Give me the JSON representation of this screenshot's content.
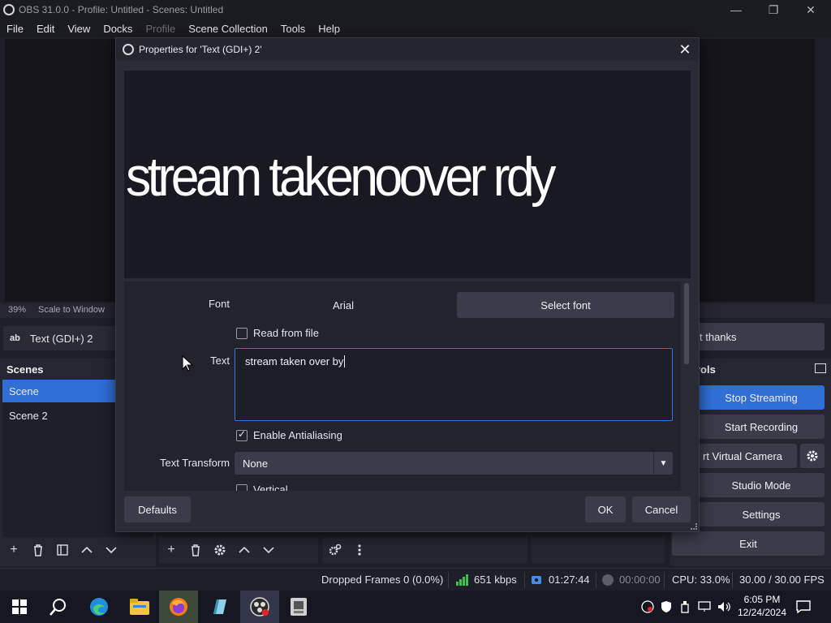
{
  "window": {
    "title": "OBS 31.0.0 - Profile: Untitled - Scenes: Untitled"
  },
  "menu": {
    "items": [
      "File",
      "Edit",
      "View",
      "Docks",
      "Profile",
      "Scene Collection",
      "Tools",
      "Help"
    ]
  },
  "preview": {
    "zoom": "39%",
    "scale_label": "Scale to Window"
  },
  "sources": {
    "icon_text": "ab",
    "selected": "Text (GDI+) 2",
    "other": "t thanks"
  },
  "scenes": {
    "title": "Scenes",
    "items": [
      "Scene",
      "Scene 2"
    ],
    "active_index": 0
  },
  "controls": {
    "title": "rols",
    "stop_streaming": "Stop Streaming",
    "start_recording": "Start Recording",
    "virtual_camera": "rt Virtual Camera",
    "studio_mode": "Studio Mode",
    "settings": "Settings",
    "exit": "Exit"
  },
  "status": {
    "dropped": "Dropped Frames 0 (0.0%)",
    "bitrate": "651 kbps",
    "stream_time": "01:27:44",
    "rec_time": "00:00:00",
    "cpu": "CPU: 33.0%",
    "fps": "30.00 / 30.00 FPS"
  },
  "dialog": {
    "title": "Properties for 'Text (GDI+) 2'",
    "preview_text": "stream takenoover rdy",
    "font_label": "Font",
    "font_value": "Arial",
    "select_font": "Select font",
    "read_from_file": "Read from file",
    "text_label": "Text",
    "text_value": "stream taken over by",
    "antialias_label": "Enable Antialiasing",
    "antialias_checked": true,
    "transform_label": "Text Transform",
    "transform_value": "None",
    "vertical_label": "Vertical",
    "defaults": "Defaults",
    "ok": "OK",
    "cancel": "Cancel"
  },
  "taskbar": {
    "time": "6:05 PM",
    "date": "12/24/2024"
  },
  "colors": {
    "accent": "#2f6fd6",
    "bg": "#1e1f29",
    "panel": "#252631"
  }
}
